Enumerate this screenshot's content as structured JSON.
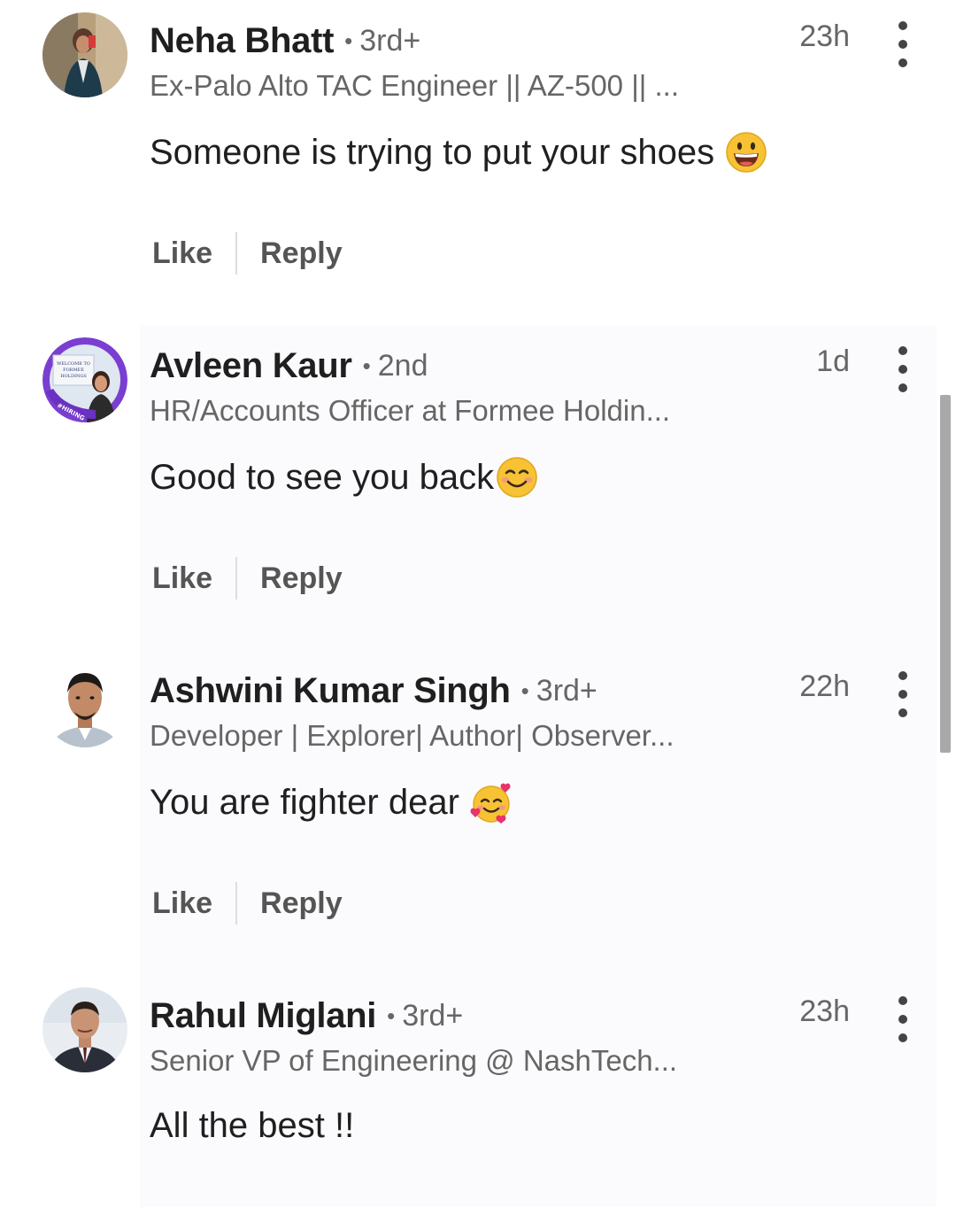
{
  "comments": [
    {
      "name": "Neha Bhatt",
      "degree": "3rd+",
      "time": "23h",
      "headline": "Ex-Palo Alto TAC Engineer || AZ-500 || ...",
      "body": "Someone is trying to put your shoes",
      "emoji": "grinning-face-emoji",
      "like": "Like",
      "reply": "Reply"
    },
    {
      "name": "Avleen Kaur",
      "degree": "2nd",
      "time": "1d",
      "headline": "HR/Accounts Officer at Formee Holdin...",
      "body": "Good to see you back",
      "emoji": "smiling-face-emoji",
      "like": "Like",
      "reply": "Reply",
      "avatar_badge": "#HIRING",
      "avatar_sign": "WELCOME TO FORMEE HOLDINGS"
    },
    {
      "name": "Ashwini Kumar Singh",
      "degree": "3rd+",
      "time": "22h",
      "headline": "Developer | Explorer| Author| Observer...",
      "body": "You are fighter dear",
      "emoji": "smiling-face-with-hearts-emoji",
      "like": "Like",
      "reply": "Reply"
    },
    {
      "name": "Rahul Miglani",
      "degree": "3rd+",
      "time": "23h",
      "headline": "Senior VP of Engineering @ NashTech...",
      "body": "All the best !!",
      "emoji": "",
      "like": "Like",
      "reply": "Reply"
    }
  ],
  "separator": "•",
  "colors": {
    "bubble_background": "#fbfbfd",
    "secondary_text": "#666666",
    "primary_text": "#1f1f1f"
  }
}
